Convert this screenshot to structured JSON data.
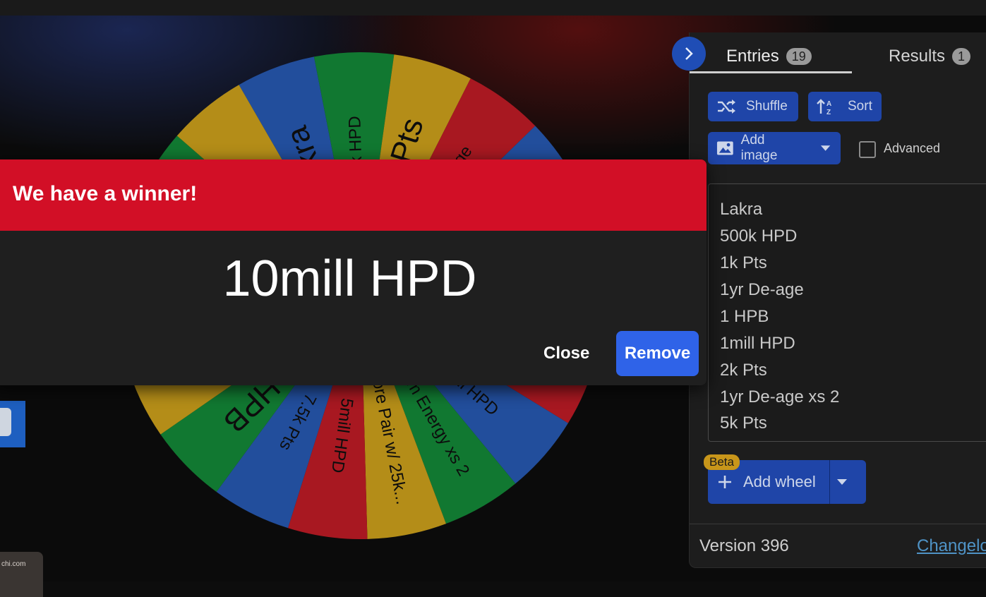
{
  "dialog": {
    "title": "We have a winner!",
    "winner": "10mill HPD",
    "close_label": "Close",
    "remove_label": "Remove"
  },
  "sidebar": {
    "tabs": [
      {
        "label": "Entries",
        "count": "19"
      },
      {
        "label": "Results",
        "count": "1"
      }
    ],
    "shuffle_label": "Shuffle",
    "sort_label": "Sort",
    "add_image_label": "Add image",
    "advanced_label": "Advanced",
    "entries": [
      "Lakra",
      "500k HPD",
      "1k Pts",
      "1yr De-age",
      "1 HPB",
      "1mill HPD",
      "2k Pts",
      "1yr De-age xs 2",
      "5k Pts"
    ],
    "beta_label": "Beta",
    "add_wheel_label": "Add wheel",
    "version": "Version 396",
    "changelog": "Changelog"
  },
  "wheel": {
    "colors": [
      "#d71f2a",
      "#2c64c8",
      "#169a3f",
      "#e7b51f"
    ],
    "segments": [
      "Lakra",
      "500k HPD",
      "1k Pts",
      "1yr De-age",
      "HPB",
      "",
      "",
      "",
      "3mill HPD",
      "Term Energy xs 2",
      "Store Pair w/ 25k...",
      "5mill HPD",
      "7.5k Pts",
      "2 HPB",
      "mill HPD"
    ]
  },
  "thumbnail_caption": "chi.com"
}
